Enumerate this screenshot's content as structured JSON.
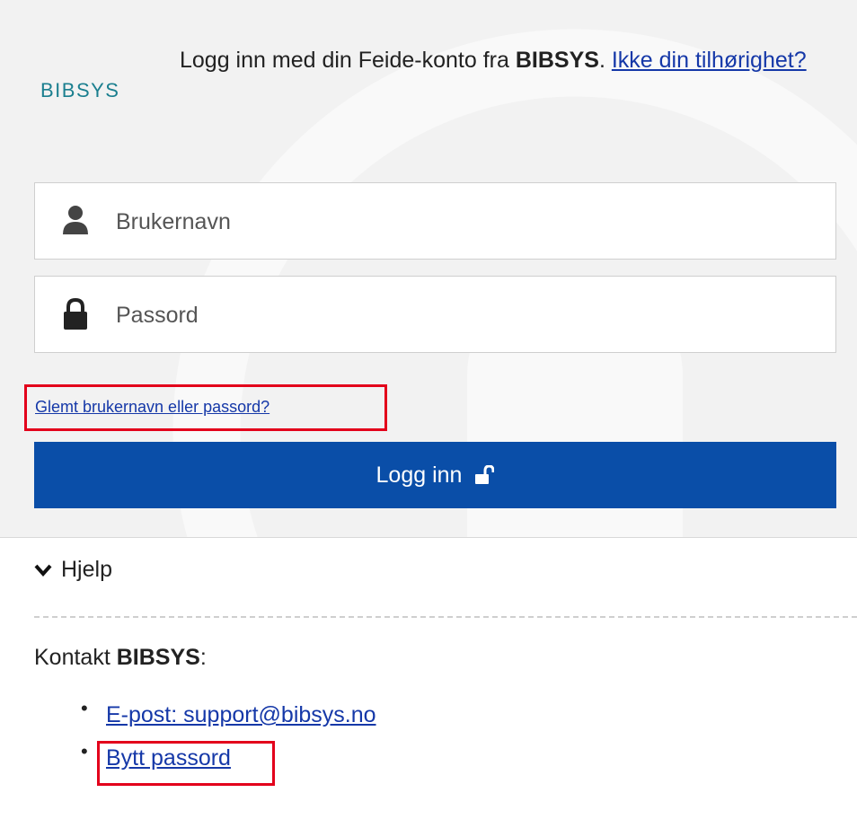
{
  "brand": {
    "logo_text": "BIBSYS",
    "logo_color": "#1b7f8f"
  },
  "intro": {
    "prefix": "Logg inn med din Feide-konto fra ",
    "org": "BIBSYS",
    "suffix": ". ",
    "change_link": "Ikke din tilhørighet?"
  },
  "form": {
    "username_placeholder": "Brukernavn",
    "password_placeholder": "Passord",
    "forgot_link": "Glemt brukernavn eller passord?",
    "login_label": "Logg inn"
  },
  "help": {
    "label": "Hjelp"
  },
  "contact": {
    "prefix": "Kontakt ",
    "org": "BIBSYS",
    "suffix": ":",
    "links": [
      "E-post: support@bibsys.no",
      "Bytt passord"
    ]
  },
  "colors": {
    "accent": "#0a4ea8",
    "link": "#1538a8",
    "highlight": "#e3001b",
    "panel_bg": "#f2f2f2"
  },
  "icons": [
    "user-icon",
    "lock-icon",
    "unlock-icon",
    "chevron-down-icon"
  ]
}
